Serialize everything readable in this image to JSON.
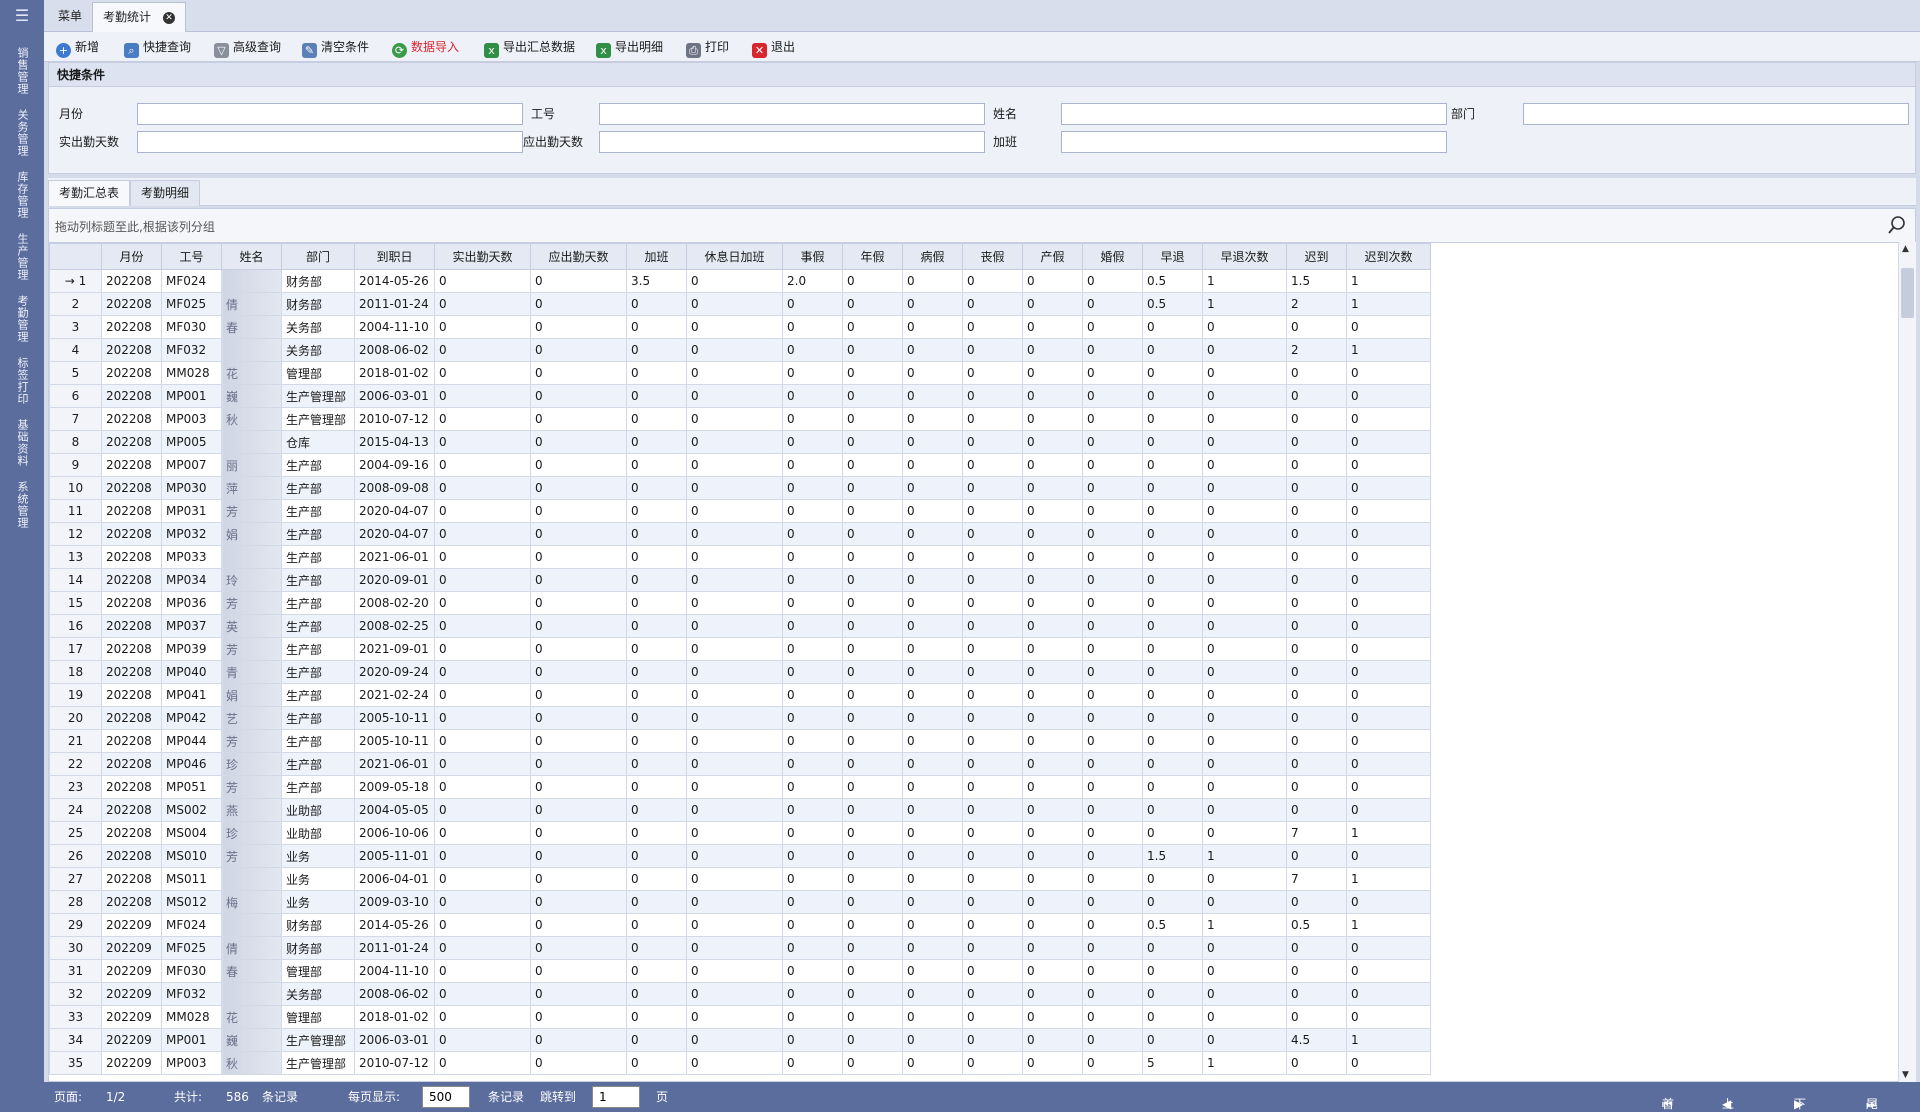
{
  "sidebar": {
    "items": [
      "销售管理",
      "关务管理",
      "库存管理",
      "生产管理",
      "考勤管理",
      "标签打印",
      "基础资料",
      "系统管理"
    ]
  },
  "tabs": {
    "menu": "菜单",
    "active": "考勤统计"
  },
  "toolbar": {
    "add": "新增",
    "quick_query": "快捷查询",
    "advanced_query": "高级查询",
    "clear": "清空条件",
    "import": "数据导入",
    "export_summary": "导出汇总数据",
    "export_detail": "导出明细",
    "print": "打印",
    "exit": "退出",
    "import_color": "#d8262e"
  },
  "filter": {
    "title": "快捷条件",
    "month": "月份",
    "emp_no": "工号",
    "name": "姓名",
    "dept": "部门",
    "actual_days": "实出勤天数",
    "due_days": "应出勤天数",
    "overtime": "加班"
  },
  "subtabs": {
    "summary": "考勤汇总表",
    "detail": "考勤明细"
  },
  "group_hint": "拖动列标题至此,根据该列分组",
  "grid": {
    "columns": [
      "月份",
      "工号",
      "姓名",
      "部门",
      "到职日",
      "实出勤天数",
      "应出勤天数",
      "加班",
      "休息日加班",
      "事假",
      "年假",
      "病假",
      "丧假",
      "产假",
      "婚假",
      "早退",
      "早退次数",
      "迟到",
      "迟到次数"
    ],
    "rows": [
      [
        "202208",
        "MF024",
        "",
        "财务部",
        "2014-05-26",
        "0",
        "0",
        "3.5",
        "0",
        "2.0",
        "0",
        "0",
        "0",
        "0",
        "0",
        "0.5",
        "1",
        "1.5",
        "1"
      ],
      [
        "202208",
        "MF025",
        "倩",
        "财务部",
        "2011-01-24",
        "0",
        "0",
        "0",
        "0",
        "0",
        "0",
        "0",
        "0",
        "0",
        "0",
        "0.5",
        "1",
        "2",
        "1"
      ],
      [
        "202208",
        "MF030",
        "春",
        "关务部",
        "2004-11-10",
        "0",
        "0",
        "0",
        "0",
        "0",
        "0",
        "0",
        "0",
        "0",
        "0",
        "0",
        "0",
        "0",
        "0"
      ],
      [
        "202208",
        "MF032",
        "",
        "关务部",
        "2008-06-02",
        "0",
        "0",
        "0",
        "0",
        "0",
        "0",
        "0",
        "0",
        "0",
        "0",
        "0",
        "0",
        "2",
        "1"
      ],
      [
        "202208",
        "MM028",
        "花",
        "管理部",
        "2018-01-02",
        "0",
        "0",
        "0",
        "0",
        "0",
        "0",
        "0",
        "0",
        "0",
        "0",
        "0",
        "0",
        "0",
        "0"
      ],
      [
        "202208",
        "MP001",
        "巍",
        "生产管理部",
        "2006-03-01",
        "0",
        "0",
        "0",
        "0",
        "0",
        "0",
        "0",
        "0",
        "0",
        "0",
        "0",
        "0",
        "0",
        "0"
      ],
      [
        "202208",
        "MP003",
        "秋",
        "生产管理部",
        "2010-07-12",
        "0",
        "0",
        "0",
        "0",
        "0",
        "0",
        "0",
        "0",
        "0",
        "0",
        "0",
        "0",
        "0",
        "0"
      ],
      [
        "202208",
        "MP005",
        "",
        "仓库",
        "2015-04-13",
        "0",
        "0",
        "0",
        "0",
        "0",
        "0",
        "0",
        "0",
        "0",
        "0",
        "0",
        "0",
        "0",
        "0"
      ],
      [
        "202208",
        "MP007",
        "丽",
        "生产部",
        "2004-09-16",
        "0",
        "0",
        "0",
        "0",
        "0",
        "0",
        "0",
        "0",
        "0",
        "0",
        "0",
        "0",
        "0",
        "0"
      ],
      [
        "202208",
        "MP030",
        "萍",
        "生产部",
        "2008-09-08",
        "0",
        "0",
        "0",
        "0",
        "0",
        "0",
        "0",
        "0",
        "0",
        "0",
        "0",
        "0",
        "0",
        "0"
      ],
      [
        "202208",
        "MP031",
        "芳",
        "生产部",
        "2020-04-07",
        "0",
        "0",
        "0",
        "0",
        "0",
        "0",
        "0",
        "0",
        "0",
        "0",
        "0",
        "0",
        "0",
        "0"
      ],
      [
        "202208",
        "MP032",
        "娟",
        "生产部",
        "2020-04-07",
        "0",
        "0",
        "0",
        "0",
        "0",
        "0",
        "0",
        "0",
        "0",
        "0",
        "0",
        "0",
        "0",
        "0"
      ],
      [
        "202208",
        "MP033",
        "",
        "生产部",
        "2021-06-01",
        "0",
        "0",
        "0",
        "0",
        "0",
        "0",
        "0",
        "0",
        "0",
        "0",
        "0",
        "0",
        "0",
        "0"
      ],
      [
        "202208",
        "MP034",
        "玲",
        "生产部",
        "2020-09-01",
        "0",
        "0",
        "0",
        "0",
        "0",
        "0",
        "0",
        "0",
        "0",
        "0",
        "0",
        "0",
        "0",
        "0"
      ],
      [
        "202208",
        "MP036",
        "芳",
        "生产部",
        "2008-02-20",
        "0",
        "0",
        "0",
        "0",
        "0",
        "0",
        "0",
        "0",
        "0",
        "0",
        "0",
        "0",
        "0",
        "0"
      ],
      [
        "202208",
        "MP037",
        "英",
        "生产部",
        "2008-02-25",
        "0",
        "0",
        "0",
        "0",
        "0",
        "0",
        "0",
        "0",
        "0",
        "0",
        "0",
        "0",
        "0",
        "0"
      ],
      [
        "202208",
        "MP039",
        "芳",
        "生产部",
        "2021-09-01",
        "0",
        "0",
        "0",
        "0",
        "0",
        "0",
        "0",
        "0",
        "0",
        "0",
        "0",
        "0",
        "0",
        "0"
      ],
      [
        "202208",
        "MP040",
        "青",
        "生产部",
        "2020-09-24",
        "0",
        "0",
        "0",
        "0",
        "0",
        "0",
        "0",
        "0",
        "0",
        "0",
        "0",
        "0",
        "0",
        "0"
      ],
      [
        "202208",
        "MP041",
        "娟",
        "生产部",
        "2021-02-24",
        "0",
        "0",
        "0",
        "0",
        "0",
        "0",
        "0",
        "0",
        "0",
        "0",
        "0",
        "0",
        "0",
        "0"
      ],
      [
        "202208",
        "MP042",
        "艺",
        "生产部",
        "2005-10-11",
        "0",
        "0",
        "0",
        "0",
        "0",
        "0",
        "0",
        "0",
        "0",
        "0",
        "0",
        "0",
        "0",
        "0"
      ],
      [
        "202208",
        "MP044",
        "芳",
        "生产部",
        "2005-10-11",
        "0",
        "0",
        "0",
        "0",
        "0",
        "0",
        "0",
        "0",
        "0",
        "0",
        "0",
        "0",
        "0",
        "0"
      ],
      [
        "202208",
        "MP046",
        "珍",
        "生产部",
        "2021-06-01",
        "0",
        "0",
        "0",
        "0",
        "0",
        "0",
        "0",
        "0",
        "0",
        "0",
        "0",
        "0",
        "0",
        "0"
      ],
      [
        "202208",
        "MP051",
        "芳",
        "生产部",
        "2009-05-18",
        "0",
        "0",
        "0",
        "0",
        "0",
        "0",
        "0",
        "0",
        "0",
        "0",
        "0",
        "0",
        "0",
        "0"
      ],
      [
        "202208",
        "MS002",
        "燕",
        "业助部",
        "2004-05-05",
        "0",
        "0",
        "0",
        "0",
        "0",
        "0",
        "0",
        "0",
        "0",
        "0",
        "0",
        "0",
        "0",
        "0"
      ],
      [
        "202208",
        "MS004",
        "珍",
        "业助部",
        "2006-10-06",
        "0",
        "0",
        "0",
        "0",
        "0",
        "0",
        "0",
        "0",
        "0",
        "0",
        "0",
        "0",
        "7",
        "1"
      ],
      [
        "202208",
        "MS010",
        "芳",
        "业务",
        "2005-11-01",
        "0",
        "0",
        "0",
        "0",
        "0",
        "0",
        "0",
        "0",
        "0",
        "0",
        "1.5",
        "1",
        "0",
        "0"
      ],
      [
        "202208",
        "MS011",
        "",
        "业务",
        "2006-04-01",
        "0",
        "0",
        "0",
        "0",
        "0",
        "0",
        "0",
        "0",
        "0",
        "0",
        "0",
        "0",
        "7",
        "1"
      ],
      [
        "202208",
        "MS012",
        "梅",
        "业务",
        "2009-03-10",
        "0",
        "0",
        "0",
        "0",
        "0",
        "0",
        "0",
        "0",
        "0",
        "0",
        "0",
        "0",
        "0",
        "0"
      ],
      [
        "202209",
        "MF024",
        "",
        "财务部",
        "2014-05-26",
        "0",
        "0",
        "0",
        "0",
        "0",
        "0",
        "0",
        "0",
        "0",
        "0",
        "0.5",
        "1",
        "0.5",
        "1"
      ],
      [
        "202209",
        "MF025",
        "倩",
        "财务部",
        "2011-01-24",
        "0",
        "0",
        "0",
        "0",
        "0",
        "0",
        "0",
        "0",
        "0",
        "0",
        "0",
        "0",
        "0",
        "0"
      ],
      [
        "202209",
        "MF030",
        "春",
        "管理部",
        "2004-11-10",
        "0",
        "0",
        "0",
        "0",
        "0",
        "0",
        "0",
        "0",
        "0",
        "0",
        "0",
        "0",
        "0",
        "0"
      ],
      [
        "202209",
        "MF032",
        "",
        "关务部",
        "2008-06-02",
        "0",
        "0",
        "0",
        "0",
        "0",
        "0",
        "0",
        "0",
        "0",
        "0",
        "0",
        "0",
        "0",
        "0"
      ],
      [
        "202209",
        "MM028",
        "花",
        "管理部",
        "2018-01-02",
        "0",
        "0",
        "0",
        "0",
        "0",
        "0",
        "0",
        "0",
        "0",
        "0",
        "0",
        "0",
        "0",
        "0"
      ],
      [
        "202209",
        "MP001",
        "巍",
        "生产管理部",
        "2006-03-01",
        "0",
        "0",
        "0",
        "0",
        "0",
        "0",
        "0",
        "0",
        "0",
        "0",
        "0",
        "0",
        "4.5",
        "1"
      ],
      [
        "202209",
        "MP003",
        "秋",
        "生产管理部",
        "2010-07-12",
        "0",
        "0",
        "0",
        "0",
        "0",
        "0",
        "0",
        "0",
        "0",
        "0",
        "5",
        "1",
        "0",
        "0"
      ]
    ]
  },
  "footer": {
    "page_label": "页面:",
    "page_value": "1/2",
    "total_label": "共计:",
    "total_value": "586",
    "records": "条记录",
    "per_page_label": "每页显示:",
    "per_page_value": "500",
    "records2": "条记录",
    "jump_label": "跳转到",
    "jump_value": "1",
    "page_unit": "页",
    "first": "首页",
    "prev": "上一页",
    "next": "下一页",
    "last": "尾页"
  }
}
